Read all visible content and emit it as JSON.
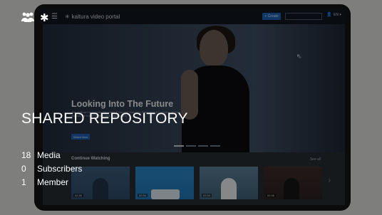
{
  "card": {
    "title": "SHARED REPOSITORY",
    "top_icons": [
      "group-icon",
      "asterisk-icon"
    ],
    "stats": [
      {
        "count": "18",
        "label": "Media"
      },
      {
        "count": "0",
        "label": "Subscribers"
      },
      {
        "count": "1",
        "label": "Member"
      }
    ]
  },
  "portal": {
    "brand": "kaltura video portal",
    "create_label": "+ Create",
    "language": "EN ▾",
    "hero": {
      "title": "Looking Into The Future",
      "subtitle": "Join Kaltura Co-founder, President & General Manager, Enterprise & Learning, as they discuss the future of video and engagement",
      "button_label": "Watch Now"
    },
    "continue_watching": {
      "title": "Continue Watching",
      "see_all": "See all",
      "durations": [
        "02:30",
        "02:34",
        "02:34",
        "02:36"
      ]
    }
  },
  "colors": {
    "overlay": "#000000",
    "accent": "#1c5fb0",
    "text": "#ffffff"
  }
}
